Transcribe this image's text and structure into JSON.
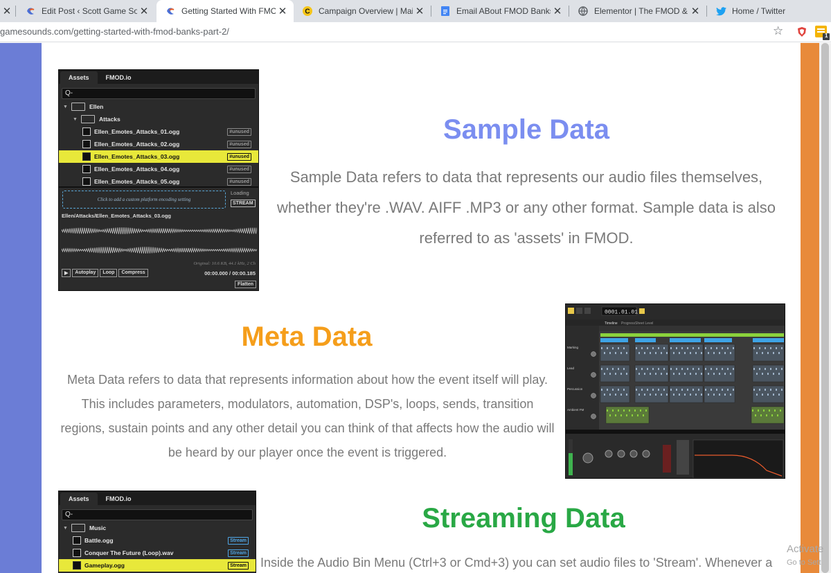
{
  "browser": {
    "tabs": [
      {
        "title": "",
        "favicon": "close-icon",
        "active": false
      },
      {
        "title": "Edit Post ‹ Scott Game Sounds",
        "favicon": "scott-logo-icon",
        "active": false
      },
      {
        "title": "Getting Started With FMOD Ba",
        "favicon": "scott-logo-icon",
        "active": true
      },
      {
        "title": "Campaign Overview | Mailchim",
        "favicon": "mailchimp-icon",
        "active": false
      },
      {
        "title": "Email ABout FMOD Banks -Tur",
        "favicon": "google-docs-icon",
        "active": false
      },
      {
        "title": "Elementor | The FMOD & Unity",
        "favicon": "globe-icon",
        "active": false
      },
      {
        "title": "Home / Twitter",
        "favicon": "twitter-icon",
        "active": false
      }
    ],
    "url": "gamesounds.com/getting-started-with-fmod-banks-part-2/",
    "ext_badge": "1"
  },
  "colors": {
    "left_band": "#6b7dd6",
    "right_band": "#e88a3a",
    "sample_heading": "#7b8ef0",
    "meta_heading": "#f59e1b",
    "stream_heading": "#29a845",
    "body_text": "#7a7a7a"
  },
  "sections": {
    "sample": {
      "heading": "Sample Data",
      "body": "Sample Data refers to data that represents our audio files themselves, whether they're .WAV. AIFF .MP3 or any other format. Sample data is also referred to as 'assets' in FMOD."
    },
    "meta": {
      "heading": "Meta Data",
      "body": "Meta Data refers to data that represents information about how the event itself will play. This includes parameters, modulators, automation, DSP's, loops, sends, transition regions, sustain points and any other detail you can think of that affects how the audio will be heard by our player once the event is triggered."
    },
    "stream": {
      "heading": "Streaming Data",
      "body": "Inside the Audio Bin Menu (Ctrl+3 or Cmd+3) you can set audio files to 'Stream'. Whenever a"
    }
  },
  "fmod_assets_panel": {
    "tab_assets": "Assets",
    "tab_fmodio": "FMOD.io",
    "search": "Q-",
    "rows": [
      {
        "label": "Ellen",
        "kind": "folder",
        "level": 0,
        "tag": "",
        "highlight": false
      },
      {
        "label": "Attacks",
        "kind": "folder",
        "level": 1,
        "tag": "",
        "highlight": false
      },
      {
        "label": "Ellen_Emotes_Attacks_01.ogg",
        "kind": "file",
        "level": 2,
        "tag": "#unused",
        "highlight": false
      },
      {
        "label": "Ellen_Emotes_Attacks_02.ogg",
        "kind": "file",
        "level": 2,
        "tag": "#unused",
        "highlight": false
      },
      {
        "label": "Ellen_Emotes_Attacks_03.ogg",
        "kind": "file",
        "level": 2,
        "tag": "#unused",
        "highlight": true
      },
      {
        "label": "Ellen_Emotes_Attacks_04.ogg",
        "kind": "file",
        "level": 2,
        "tag": "#unused",
        "highlight": false
      },
      {
        "label": "Ellen_Emotes_Attacks_05.ogg",
        "kind": "file",
        "level": 2,
        "tag": "#unused",
        "highlight": false
      }
    ],
    "encoding_hint": "Click to add a custom platform encoding setting",
    "loading_label": "Loading",
    "stream_button": "STREAM",
    "selected_path": "Ellen/Attacks/Ellen_Emotes_Attacks_03.ogg",
    "original_info": "Original: 10.6 KB, 44.1 kHz, 2 Ch",
    "controls": [
      "Autoplay",
      "Loop",
      "Compress"
    ],
    "time": "00:00.000 / 00:00.185",
    "flatten": "Flatten"
  },
  "fmod_music_panel": {
    "tab_assets": "Assets",
    "tab_fmodio": "FMOD.io",
    "search": "Q-",
    "rows": [
      {
        "label": "Music",
        "kind": "folder",
        "level": 0,
        "tag": "",
        "highlight": false
      },
      {
        "label": "Battle.ogg",
        "kind": "file",
        "level": 1,
        "tag": "Stream",
        "highlight": false
      },
      {
        "label": "Conquer The Future (Loop).wav",
        "kind": "file",
        "level": 1,
        "tag": "Stream",
        "highlight": false
      },
      {
        "label": "Gameplay.ogg",
        "kind": "file",
        "level": 1,
        "tag": "Stream",
        "highlight": true
      }
    ]
  },
  "fmod_event_editor": {
    "timecode": "0001.01.01",
    "tabs": [
      "Timeline",
      "Progress",
      "Sheet Level"
    ],
    "tracks": [
      "Marking",
      "Lead",
      "Percussion",
      "Ambient FM"
    ]
  },
  "watermark": {
    "line1": "Activate",
    "line2": "Go to Sett"
  }
}
